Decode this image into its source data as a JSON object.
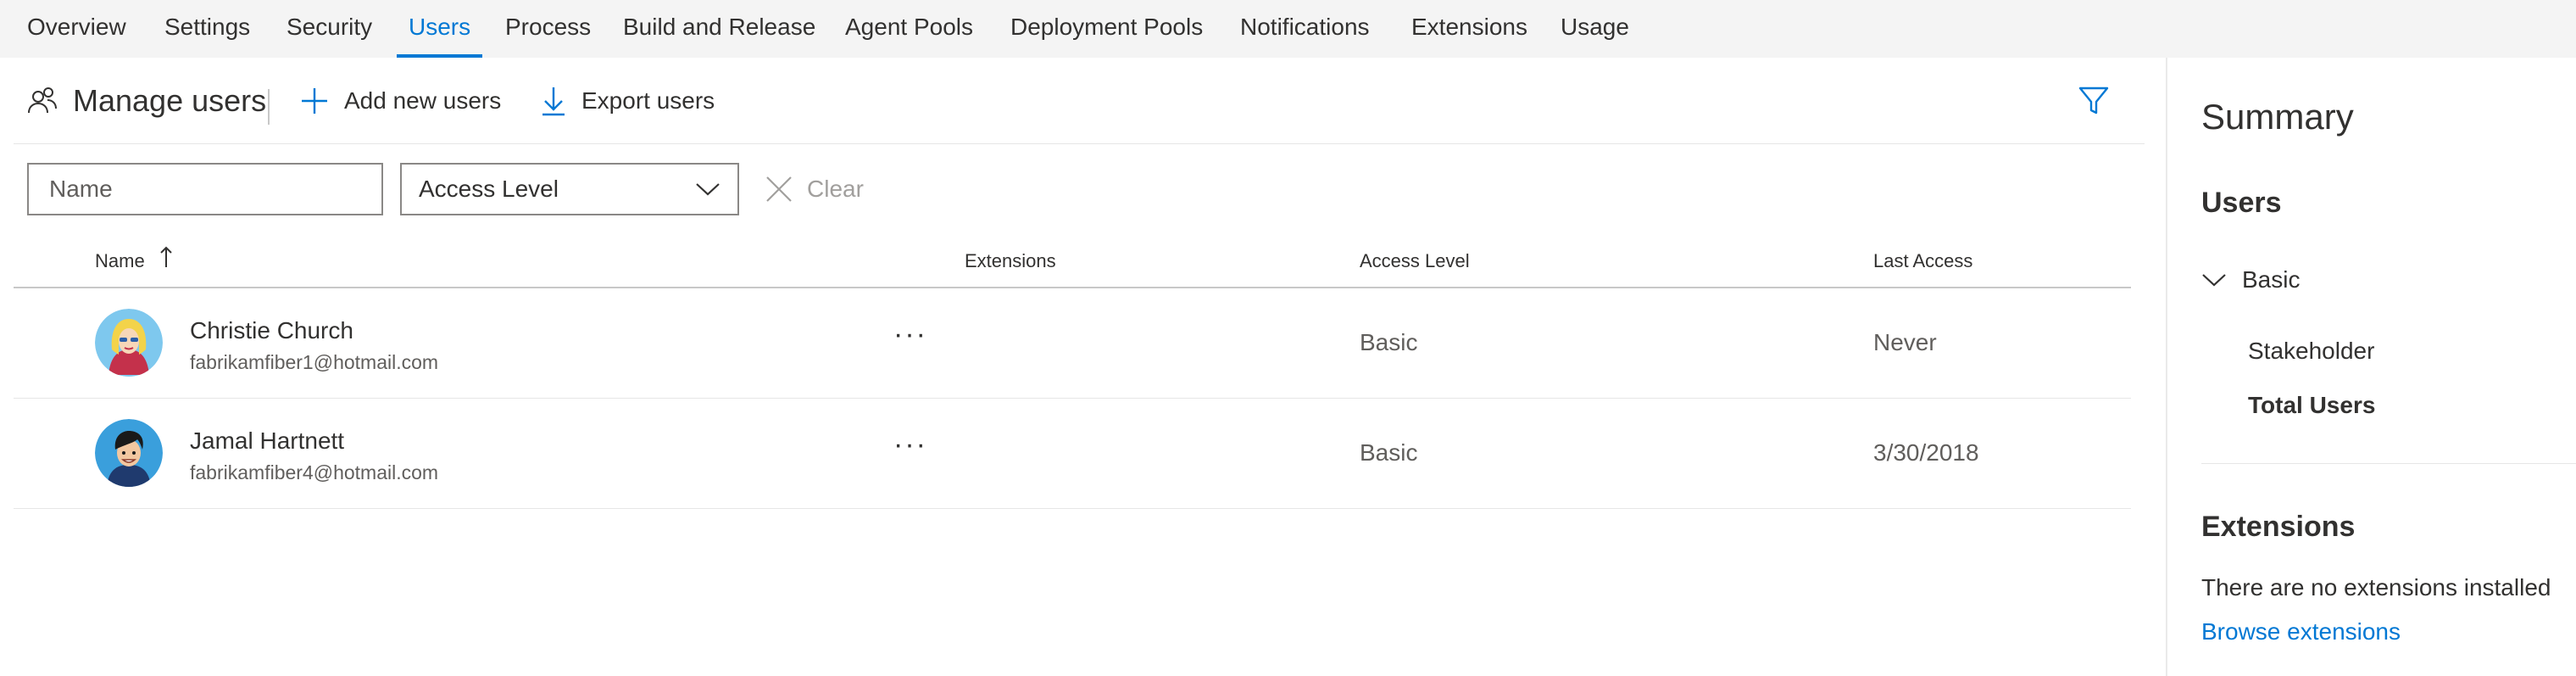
{
  "tabs": [
    {
      "label": "Overview"
    },
    {
      "label": "Settings"
    },
    {
      "label": "Security"
    },
    {
      "label": "Users",
      "active": true
    },
    {
      "label": "Process"
    },
    {
      "label": "Build and Release"
    },
    {
      "label": "Agent Pools"
    },
    {
      "label": "Deployment Pools"
    },
    {
      "label": "Notifications"
    },
    {
      "label": "Extensions"
    },
    {
      "label": "Usage"
    }
  ],
  "toolbar": {
    "title": "Manage users",
    "add_label": "Add new users",
    "export_label": "Export users"
  },
  "filters": {
    "name_placeholder": "Name",
    "access_level_label": "Access Level",
    "clear_label": "Clear"
  },
  "table": {
    "columns": [
      "Name",
      "Extensions",
      "Access Level",
      "Last Access"
    ],
    "rows": [
      {
        "name": "Christie Church",
        "email": "fabrikamfiber1@hotmail.com",
        "more": "···",
        "access_level": "Basic",
        "last_access": "Never"
      },
      {
        "name": "Jamal Hartnett",
        "email": "fabrikamfiber4@hotmail.com",
        "more": "···",
        "access_level": "Basic",
        "last_access": "3/30/2018"
      }
    ]
  },
  "summary": {
    "title": "Summary",
    "users_heading": "Users",
    "basic_label": "Basic",
    "stakeholder_label": "Stakeholder",
    "total_users_label": "Total Users",
    "extensions_heading": "Extensions",
    "no_extensions_text": "There are no extensions installed",
    "browse_link": "Browse extensions"
  },
  "colors": {
    "accent": "#0078d4",
    "tabbar_bg": "#f4f4f4",
    "text": "#323130",
    "muted": "#605e5c"
  }
}
